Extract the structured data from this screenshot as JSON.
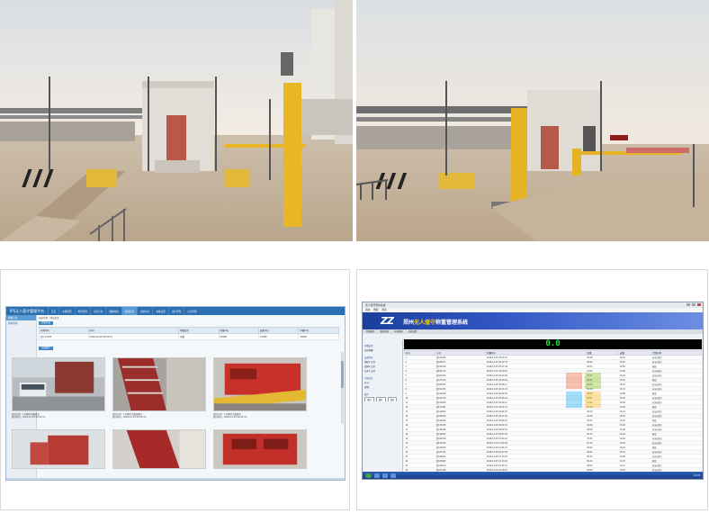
{
  "left_app": {
    "brand": "IPS无人值守管理平台",
    "nav": [
      "首页",
      "车辆管理",
      "称重管理",
      "过磅记录",
      "图像抓拍",
      "视频监控",
      "报表统计",
      "系统设置",
      "用户管理",
      "日志管理"
    ],
    "active_nav_index": 5,
    "sidebar": [
      "抓拍记录",
      "抓拍查询"
    ],
    "breadcrumb": "当前位置：抓拍记录",
    "tag": "抓拍信息",
    "table_headers": [
      "车牌号码",
      "时间",
      "称重类型",
      "毛重(kg)",
      "皮重(kg)",
      "净重(kg)"
    ],
    "table_row": [
      "蒙A·12345",
      "2018-12-05 09:32:11",
      "毛重",
      "49280",
      "15280",
      "34000"
    ],
    "section_tag": "抓拍图片",
    "captions": [
      "抓拍位置：1号地磅 前摄像头",
      "抓拍时间：2018-12-05 09:32:11",
      "抓拍位置：1号地磅 顶部摄像头",
      "抓拍时间：2018-12-05 09:32:12",
      "抓拍位置：1号地磅 后摄像头",
      "抓拍时间：2018-12-05 09:32:12"
    ]
  },
  "right_app": {
    "window_title": "无人值守称重系统",
    "menu": [
      "系统",
      "数据",
      "帮助"
    ],
    "logo": "ZZ",
    "banner_title_a": "郑州",
    "banner_title_b": "无人值守",
    "banner_title_c": "称重管理系统",
    "toolbar": [
      "称重操作",
      "数据查询",
      "车辆管理",
      "系统设置"
    ],
    "weight_display": "0.0",
    "side": {
      "h1": "称重设置",
      "item1": "自动称重",
      "h2": "设备状态",
      "s1": "地磅1  正常",
      "s2": "道闸1  正常",
      "s3": "红外1  正常",
      "h3": "车辆信息",
      "v1": "车号：",
      "v2": "货物：",
      "h4": "操作",
      "b1": "抬杆",
      "b2": "落杆",
      "b3": "保存"
    },
    "table_headers": [
      "序号",
      "车号",
      "称重时间",
      "毛重",
      "皮重",
      "货物名称"
    ],
    "rows": [
      [
        "1",
        "蒙A12345",
        "2018-12-05 09:12:01",
        "49.28",
        "15.28",
        "石灰石(粒)"
      ],
      [
        "2",
        "蒙A22871",
        "2018-12-05 09:14:33",
        "48.90",
        "15.10",
        "石灰石(粒)"
      ],
      [
        "3",
        "蒙A30419",
        "2018-12-05 09:17:48",
        "50.02",
        "15.62",
        "原煤"
      ],
      [
        "4",
        "蒙K55720",
        "2018-12-05 09:20:05",
        "47.66",
        "14.96",
        "石灰石(粒)"
      ],
      [
        "5",
        "蒙A61903",
        "2018-12-05 09:23:40",
        "49.12",
        "15.34",
        "石灰石(块)"
      ],
      [
        "6",
        "蒙A77162",
        "2018-12-05 09:25:59",
        "48.44",
        "15.02",
        "原煤"
      ],
      [
        "7",
        "蒙A80233",
        "2018-12-05 09:28:17",
        "49.80",
        "15.40",
        "石灰石(粒)"
      ],
      [
        "8",
        "蒙K91305",
        "2018-12-05 09:31:22",
        "50.36",
        "15.72",
        "石灰石(块)"
      ],
      [
        "9",
        "蒙A10478",
        "2018-12-05 09:34:06",
        "48.08",
        "14.88",
        "原煤"
      ],
      [
        "10",
        "蒙A11529",
        "2018-12-05 09:36:44",
        "49.54",
        "15.26",
        "石灰石(粒)"
      ],
      [
        "11",
        "蒙A12630",
        "2018-12-05 09:39:10",
        "47.92",
        "15.06",
        "石灰石(粒)"
      ],
      [
        "12",
        "蒙K13781",
        "2018-12-05 09:41:57",
        "50.18",
        "15.58",
        "原煤"
      ],
      [
        "13",
        "蒙A14832",
        "2018-12-05 09:44:30",
        "48.70",
        "15.14",
        "石灰石(块)"
      ],
      [
        "14",
        "蒙A15903",
        "2018-12-05 09:47:02",
        "49.36",
        "15.30",
        "石灰石(粒)"
      ],
      [
        "15",
        "蒙A16054",
        "2018-12-05 09:49:41",
        "48.22",
        "14.92",
        "原煤"
      ],
      [
        "16",
        "蒙K17185",
        "2018-12-05 09:52:18",
        "49.96",
        "15.48",
        "石灰石(粒)"
      ],
      [
        "17",
        "蒙A18296",
        "2018-12-05 09:54:55",
        "48.58",
        "15.08",
        "石灰石(块)"
      ],
      [
        "18",
        "蒙A19307",
        "2018-12-05 09:57:29",
        "49.70",
        "15.44",
        "原煤"
      ],
      [
        "19",
        "蒙A20418",
        "2018-12-05 10:00:03",
        "47.84",
        "14.90",
        "石灰石(粒)"
      ],
      [
        "20",
        "蒙K21529",
        "2018-12-05 10:02:46",
        "50.10",
        "15.64",
        "石灰石(粒)"
      ],
      [
        "21",
        "蒙A22630",
        "2018-12-05 10:05:21",
        "48.96",
        "15.16",
        "原煤"
      ],
      [
        "22",
        "蒙A23741",
        "2018-12-05 10:07:58",
        "49.42",
        "15.32",
        "石灰石(块)"
      ],
      [
        "23",
        "蒙A24852",
        "2018-12-05 10:10:34",
        "48.30",
        "14.98",
        "石灰石(粒)"
      ],
      [
        "24",
        "蒙K25963",
        "2018-12-05 10:13:09",
        "50.24",
        "15.70",
        "原煤"
      ],
      [
        "25",
        "蒙A26074",
        "2018-12-05 10:15:47",
        "48.66",
        "15.12",
        "石灰石(粒)"
      ],
      [
        "26",
        "蒙A27185",
        "2018-12-05 10:18:20",
        "49.58",
        "15.36",
        "石灰石(块)"
      ],
      [
        "27",
        "蒙A28296",
        "2018-12-05 10:20:59",
        "48.14",
        "14.94",
        "原煤"
      ],
      [
        "28",
        "蒙K29307",
        "2018-12-05 10:23:33",
        "49.88",
        "15.46",
        "石灰石(粒)"
      ],
      [
        "29",
        "蒙A30418",
        "2018-12-05 10:26:08",
        "48.52",
        "15.04",
        "石灰石(粒)"
      ],
      [
        "30",
        "蒙A31529",
        "2018-12-05 10:28:45",
        "49.74",
        "15.42",
        "原煤"
      ],
      [
        "31",
        "蒙A32630",
        "2018-12-05 10:31:19",
        "48.00",
        "14.86",
        "石灰石(块)"
      ],
      [
        "32",
        "蒙K33741",
        "2018-12-05 10:33:56",
        "50.30",
        "15.76",
        "石灰石(粒)"
      ]
    ],
    "clock": "10:35"
  }
}
